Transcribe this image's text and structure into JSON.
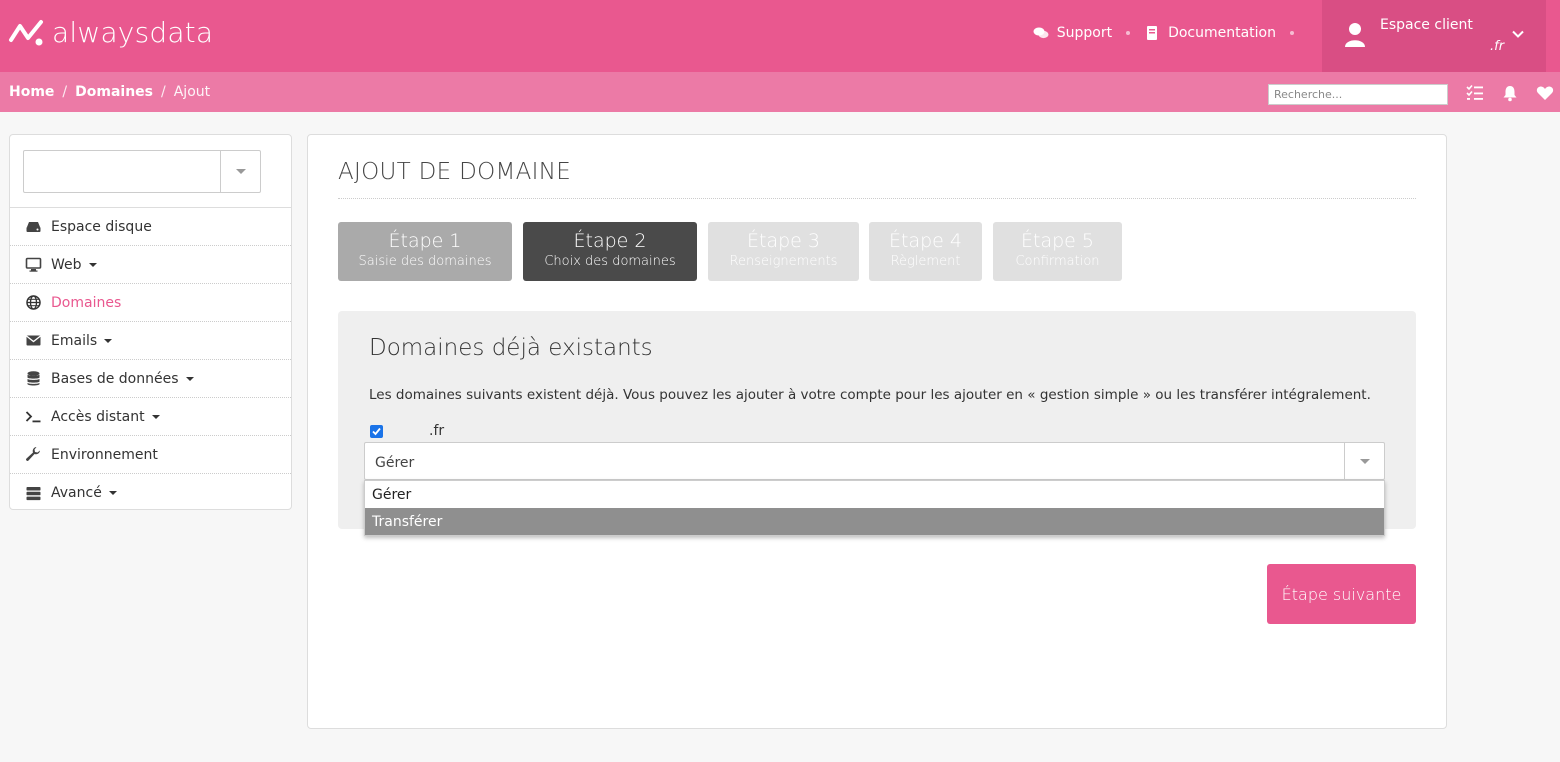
{
  "brand": {
    "name": "alwaysdata",
    "color": "#e9588f"
  },
  "topnav": {
    "support_label": "Support",
    "documentation_label": "Documentation",
    "account_title": "Espace client",
    "account_subtitle": ".fr"
  },
  "breadcrumb": {
    "home": "Home",
    "sep1": "/",
    "section": "Domaines",
    "sep2": "/",
    "current": "Ajout"
  },
  "search": {
    "placeholder": "Recherche..."
  },
  "sidebar": {
    "items": [
      {
        "label": "Espace disque",
        "icon": "disk-icon",
        "dropdown": false
      },
      {
        "label": "Web",
        "icon": "monitor-icon",
        "dropdown": true
      },
      {
        "label": "Domaines",
        "icon": "globe-icon",
        "dropdown": false,
        "active": true
      },
      {
        "label": "Emails",
        "icon": "envelope-icon",
        "dropdown": true
      },
      {
        "label": "Bases de données",
        "icon": "database-icon",
        "dropdown": true
      },
      {
        "label": "Accès distant",
        "icon": "terminal-icon",
        "dropdown": true
      },
      {
        "label": "Environnement",
        "icon": "wrench-icon",
        "dropdown": false
      },
      {
        "label": "Avancé",
        "icon": "server-icon",
        "dropdown": true
      }
    ]
  },
  "main": {
    "title": "AJOUT DE DOMAINE",
    "steps": [
      {
        "number": "Étape 1",
        "label": "Saisie des domaines",
        "state": "done"
      },
      {
        "number": "Étape 2",
        "label": "Choix des domaines",
        "state": "current"
      },
      {
        "number": "Étape 3",
        "label": "Renseignements",
        "state": "pending"
      },
      {
        "number": "Étape 4",
        "label": "Règlement",
        "state": "pending"
      },
      {
        "number": "Étape 5",
        "label": "Confirmation",
        "state": "pending"
      }
    ],
    "existing": {
      "title": "Domaines déjà existants",
      "description": "Les domaines suivants existent déjà. Vous pouvez les ajouter à votre compte pour les ajouter en « gestion simple » ou les transférer intégralement.",
      "domain": ".fr",
      "checked": true,
      "select_value": "Gérer",
      "options": [
        "Gérer",
        "Transférer"
      ],
      "highlighted_option": "Transférer"
    },
    "next_button": "Étape suivante"
  }
}
